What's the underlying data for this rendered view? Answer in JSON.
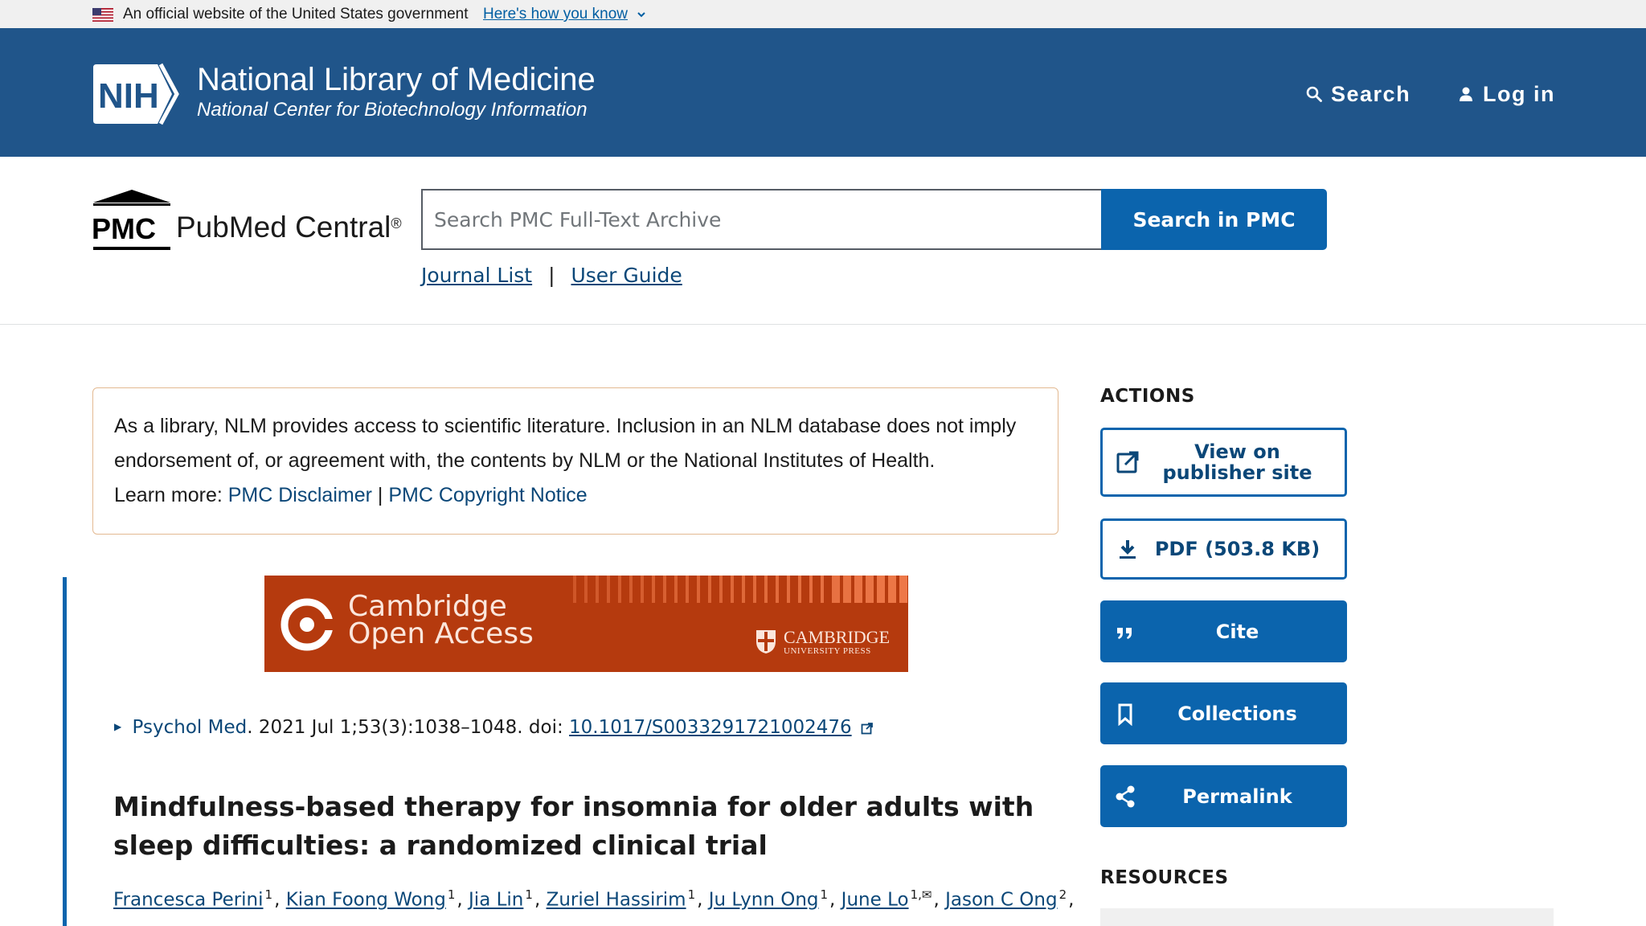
{
  "gov_banner": {
    "text": "An official website of the United States government",
    "link": "Here's how you know"
  },
  "header": {
    "logo_text": "NIH",
    "title": "National Library of Medicine",
    "subtitle": "National Center for Biotechnology Information",
    "search_label": "Search",
    "login_label": "Log in"
  },
  "pmc": {
    "logo_word": "PMC",
    "name": "PubMed Central",
    "reg": "®",
    "search_placeholder": "Search PMC Full-Text Archive",
    "search_button": "Search in PMC",
    "nav": {
      "journal_list": "Journal List",
      "separator": "|",
      "user_guide": "User Guide"
    }
  },
  "disclaimer": {
    "text": "As a library, NLM provides access to scientific literature. Inclusion in an NLM database does not imply endorsement of, or agreement with, the contents by NLM or the National Institutes of Health.",
    "learn_more": "Learn more:",
    "link1": "PMC Disclaimer",
    "sep": "|",
    "link2": "PMC Copyright Notice"
  },
  "banner": {
    "line1": "Cambridge",
    "line2": "Open Access",
    "press_big": "CAMBRIDGE",
    "press_small": "UNIVERSITY PRESS",
    "colors": {
      "background": "#b53a0e",
      "stripes": "#ef7a4a"
    }
  },
  "citation": {
    "journal": "Psychol Med",
    "details": ". 2021 Jul 1;53(3):1038–1048. doi: ",
    "doi": "10.1017/S0033291721002476"
  },
  "article": {
    "title": "Mindfulness-based therapy for insomnia for older adults with sleep difficulties: a randomized clinical trial",
    "authors": [
      {
        "name": "Francesca Perini",
        "sup": "1"
      },
      {
        "name": "Kian Foong Wong",
        "sup": "1"
      },
      {
        "name": "Jia Lin",
        "sup": "1"
      },
      {
        "name": "Zuriel Hassirim",
        "sup": "1"
      },
      {
        "name": "Ju Lynn Ong",
        "sup": "1"
      },
      {
        "name": "June Lo",
        "sup": "1,✉"
      },
      {
        "name": "Jason C Ong",
        "sup": "2"
      }
    ]
  },
  "sidebar": {
    "actions_heading": "ACTIONS",
    "publisher_line1": "View on",
    "publisher_line2": "publisher site",
    "pdf": "PDF (503.8 KB)",
    "cite": "Cite",
    "collections": "Collections",
    "permalink": "Permalink",
    "resources_heading": "RESOURCES",
    "icons": [
      "external-link-icon",
      "download-icon",
      "quote-icon",
      "bookmark-icon",
      "share-icon"
    ]
  },
  "colors": {
    "header": "#20558a",
    "primary": "#0b64ad",
    "link": "#0b4778"
  }
}
